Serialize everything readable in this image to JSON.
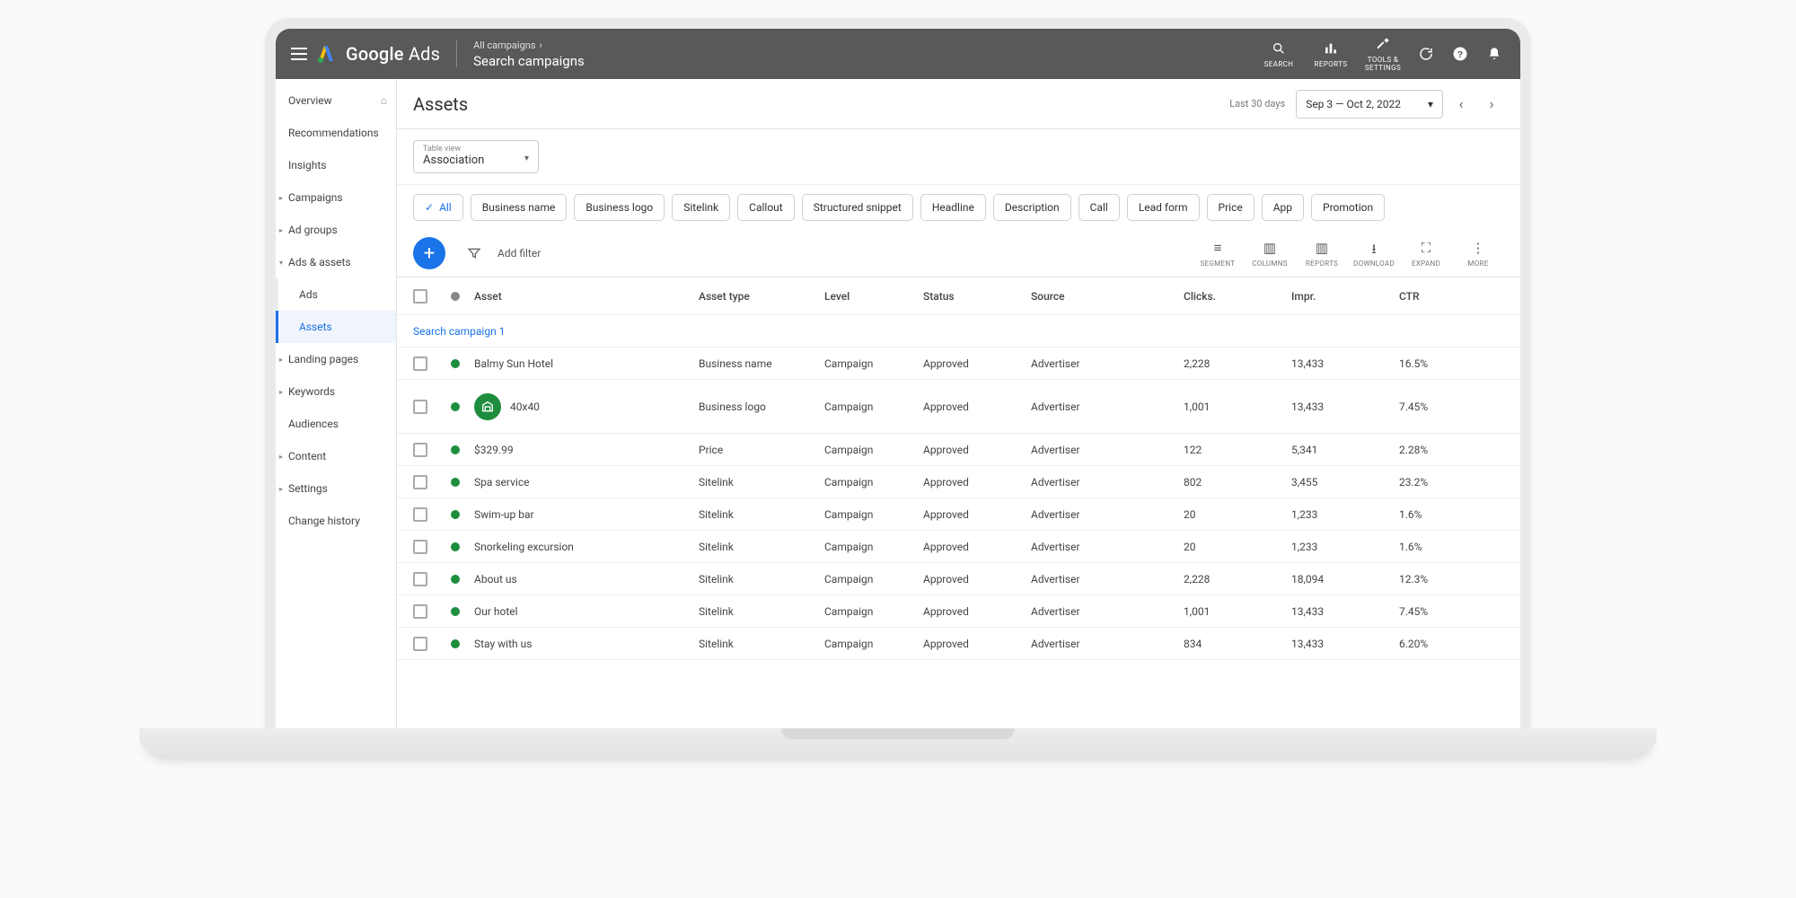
{
  "brand_prefix": "Google",
  "brand_suffix": "Ads",
  "breadcrumb": {
    "top": "All campaigns",
    "title": "Search campaigns"
  },
  "tools": {
    "search": "SEARCH",
    "reports": "REPORTS",
    "settings": "TOOLS & SETTINGS"
  },
  "sidebar": {
    "items": [
      {
        "label": "Overview",
        "home": true
      },
      {
        "label": "Recommendations"
      },
      {
        "label": "Insights"
      },
      {
        "label": "Campaigns",
        "caret": true
      },
      {
        "label": "Ad groups",
        "caret": true
      },
      {
        "label": "Ads & assets",
        "caret": true,
        "expanded": true
      },
      {
        "label": "Ads",
        "child": true
      },
      {
        "label": "Assets",
        "child": true,
        "active": true
      },
      {
        "label": "Landing pages",
        "caret": true
      },
      {
        "label": "Keywords",
        "caret": true
      },
      {
        "label": "Audiences"
      },
      {
        "label": "Content",
        "caret": true
      },
      {
        "label": "Settings",
        "caret": true
      },
      {
        "label": "Change history"
      }
    ]
  },
  "page": {
    "title": "Assets",
    "date_hint": "Last 30 days",
    "date_range": "Sep 3 — Oct 2, 2022"
  },
  "tableview": {
    "label": "Table view",
    "value": "Association"
  },
  "chips": [
    "All",
    "Business name",
    "Business logo",
    "Sitelink",
    "Callout",
    "Structured snippet",
    "Headline",
    "Description",
    "Call",
    "Lead form",
    "Price",
    "App",
    "Promotion"
  ],
  "add_filter": "Add filter",
  "toolbuttons": {
    "segment": "SEGMENT",
    "columns": "COLUMNS",
    "reports": "REPORTS",
    "download": "DOWNLOAD",
    "expand": "EXPAND",
    "more": "MORE"
  },
  "columns": {
    "asset": "Asset",
    "type": "Asset type",
    "level": "Level",
    "status": "Status",
    "source": "Source",
    "clicks": "Clicks.",
    "impr": "Impr.",
    "ctr": "CTR"
  },
  "group_label": "Search campaign 1",
  "rows": [
    {
      "asset": "Balmy Sun Hotel",
      "type": "Business name",
      "level": "Campaign",
      "status": "Approved",
      "source": "Advertiser",
      "clicks": "2,228",
      "impr": "13,433",
      "ctr": "16.5%"
    },
    {
      "asset": "40x40",
      "type": "Business logo",
      "level": "Campaign",
      "status": "Approved",
      "source": "Advertiser",
      "clicks": "1,001",
      "impr": "13,433",
      "ctr": "7.45%",
      "logo": true
    },
    {
      "asset": "$329.99",
      "type": "Price",
      "level": "Campaign",
      "status": "Approved",
      "source": "Advertiser",
      "clicks": "122",
      "impr": "5,341",
      "ctr": "2.28%"
    },
    {
      "asset": "Spa service",
      "type": "Sitelink",
      "level": "Campaign",
      "status": "Approved",
      "source": "Advertiser",
      "clicks": "802",
      "impr": "3,455",
      "ctr": "23.2%"
    },
    {
      "asset": "Swim-up bar",
      "type": "Sitelink",
      "level": "Campaign",
      "status": "Approved",
      "source": "Advertiser",
      "clicks": "20",
      "impr": "1,233",
      "ctr": "1.6%"
    },
    {
      "asset": "Snorkeling excursion",
      "type": "Sitelink",
      "level": "Campaign",
      "status": "Approved",
      "source": "Advertiser",
      "clicks": "20",
      "impr": "1,233",
      "ctr": "1.6%"
    },
    {
      "asset": "About us",
      "type": "Sitelink",
      "level": "Campaign",
      "status": "Approved",
      "source": "Advertiser",
      "clicks": "2,228",
      "impr": "18,094",
      "ctr": "12.3%"
    },
    {
      "asset": "Our hotel",
      "type": "Sitelink",
      "level": "Campaign",
      "status": "Approved",
      "source": "Advertiser",
      "clicks": "1,001",
      "impr": "13,433",
      "ctr": "7.45%"
    },
    {
      "asset": "Stay with us",
      "type": "Sitelink",
      "level": "Campaign",
      "status": "Approved",
      "source": "Advertiser",
      "clicks": "834",
      "impr": "13,433",
      "ctr": "6.20%"
    }
  ]
}
